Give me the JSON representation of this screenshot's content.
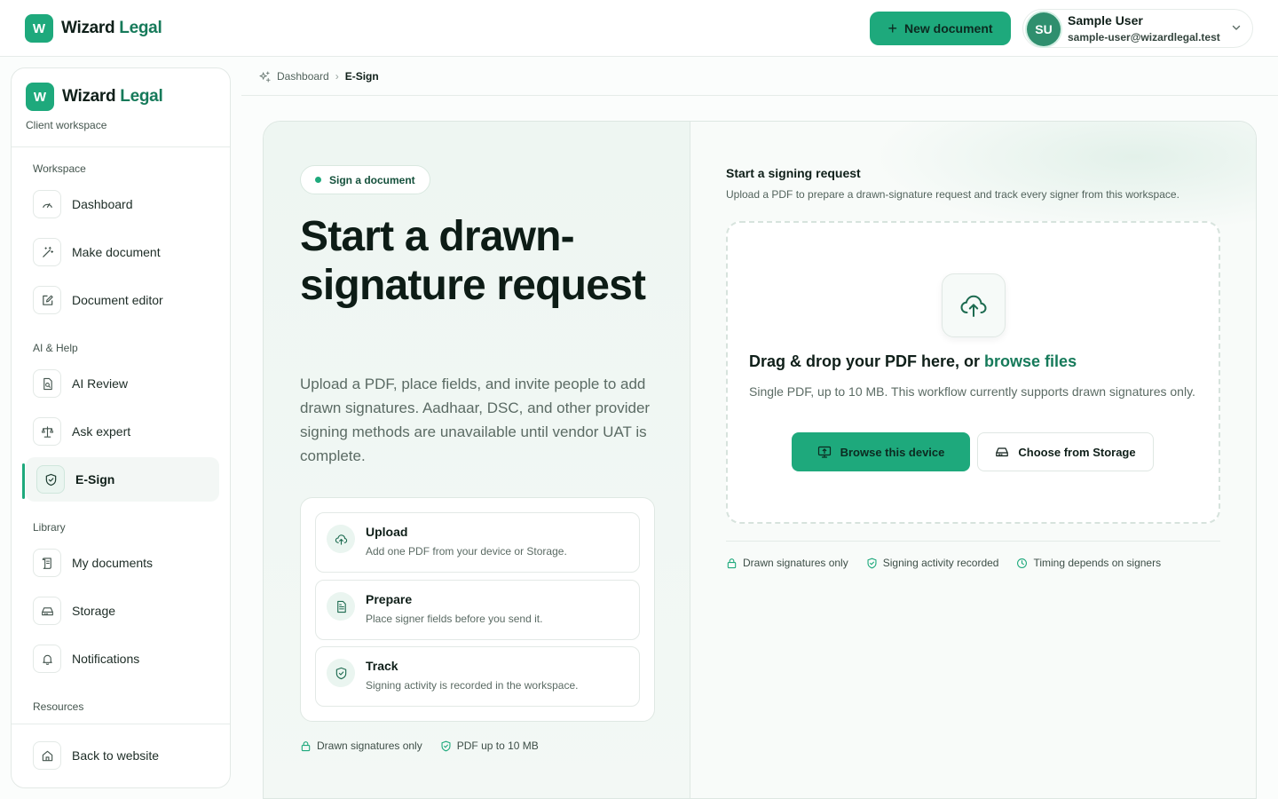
{
  "brand": {
    "initial": "W",
    "name_main": "Wizard",
    "name_accent": "Legal"
  },
  "topbar": {
    "new_document_label": "New document",
    "user": {
      "initials": "SU",
      "name": "Sample User",
      "email": "sample-user@wizardlegal.test"
    }
  },
  "sidebar": {
    "subtitle": "Client workspace",
    "sections": {
      "workspace": "Workspace",
      "ai_help": "AI & Help",
      "library": "Library",
      "resources": "Resources"
    },
    "items": {
      "dashboard": "Dashboard",
      "make_document": "Make document",
      "document_editor": "Document editor",
      "ai_review": "AI Review",
      "ask_expert": "Ask expert",
      "esign": "E-Sign",
      "my_documents": "My documents",
      "storage": "Storage",
      "notifications": "Notifications",
      "back_to_website": "Back to website"
    },
    "active_item": "esign"
  },
  "breadcrumb": {
    "parent": "Dashboard",
    "current": "E-Sign"
  },
  "hero": {
    "pill": "Sign a document",
    "title": "Start a drawn-signature request",
    "body": "Upload a PDF, place fields, and invite people to add drawn signatures. Aadhaar, DSC, and other provider signing methods are unavailable until vendor UAT is complete."
  },
  "steps": [
    {
      "title": "Upload",
      "desc": "Add one PDF from your device or Storage.",
      "icon": "cloud-upload-icon"
    },
    {
      "title": "Prepare",
      "desc": "Place signer fields before you send it.",
      "icon": "document-icon"
    },
    {
      "title": "Track",
      "desc": "Signing activity is recorded in the workspace.",
      "icon": "shield-check-icon"
    }
  ],
  "left_badges": {
    "drawn": "Drawn signatures only",
    "pdf": "PDF up to 10 MB"
  },
  "request": {
    "title": "Start a signing request",
    "subtitle": "Upload a PDF to prepare a drawn-signature request and track every signer from this workspace.",
    "drop_title": "Drag & drop your PDF here, or ",
    "drop_link": "browse files",
    "drop_desc": "Single PDF, up to 10 MB. This workflow currently supports drawn signatures only.",
    "browse_label": "Browse this device",
    "storage_label": "Choose from Storage"
  },
  "right_badges": {
    "drawn": "Drawn signatures only",
    "activity": "Signing activity recorded",
    "timing": "Timing depends on signers"
  },
  "colors": {
    "accent": "#1ea97c",
    "accent_dark": "#167a5a",
    "text": "#0f1f19"
  }
}
